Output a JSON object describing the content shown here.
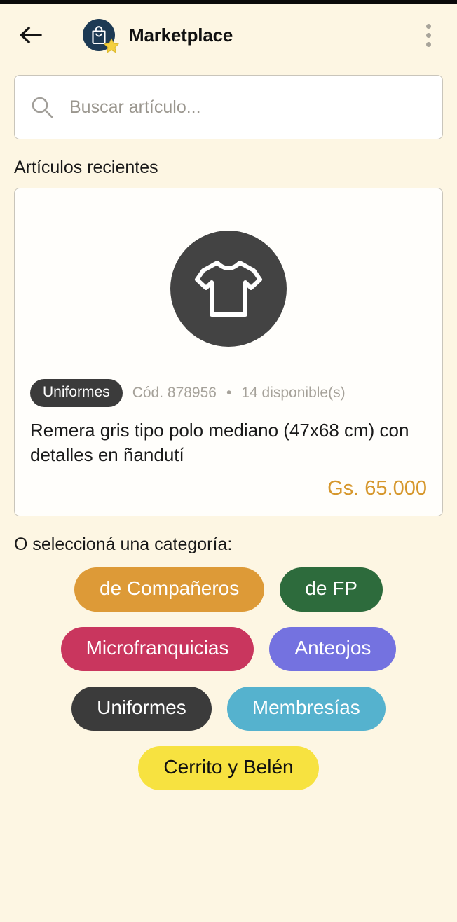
{
  "app_bar": {
    "back_label": "back",
    "title": "Marketplace",
    "logo_icon": "shopping-bag-star-icon",
    "overflow_icon": "more-vertical-icon",
    "logo_bg": "#1d3a54",
    "star_color": "#f4d03f"
  },
  "search": {
    "placeholder": "Buscar artículo...",
    "value": "",
    "icon": "search-icon"
  },
  "recent": {
    "heading": "Artículos recientes",
    "product": {
      "image_icon": "tshirt-icon",
      "image_circle_color": "#434343",
      "category_badge": "Uniformes",
      "code": "Cód. 878956",
      "separator": "•",
      "availability": "14 disponible(s)",
      "title": "Remera gris tipo polo mediano (47x68 cm) con detalles en ñandutí",
      "price": "Gs. 65.000",
      "price_color": "#d6972c"
    }
  },
  "categories": {
    "heading": "O seleccioná una categoría:",
    "rows": [
      [
        {
          "label": "de Compañeros",
          "color": "#dd9a37",
          "text_color": "#ffffff"
        },
        {
          "label": "de FP",
          "color": "#2d6b3c",
          "text_color": "#ffffff"
        }
      ],
      [
        {
          "label": "Microfranquicias",
          "color": "#c9365e",
          "text_color": "#ffffff"
        },
        {
          "label": "Anteojos",
          "color": "#7472e0",
          "text_color": "#ffffff"
        }
      ],
      [
        {
          "label": "Uniformes",
          "color": "#3b3b3b",
          "text_color": "#ffffff"
        },
        {
          "label": "Membresías",
          "color": "#55b2ce",
          "text_color": "#ffffff"
        }
      ],
      [
        {
          "label": "Cerrito y Belén",
          "color": "#f7e240",
          "text_color": "#101010"
        }
      ]
    ]
  },
  "theme": {
    "background": "#fdf6e3",
    "card_background": "#fffefb",
    "border": "#c9c5bb"
  }
}
